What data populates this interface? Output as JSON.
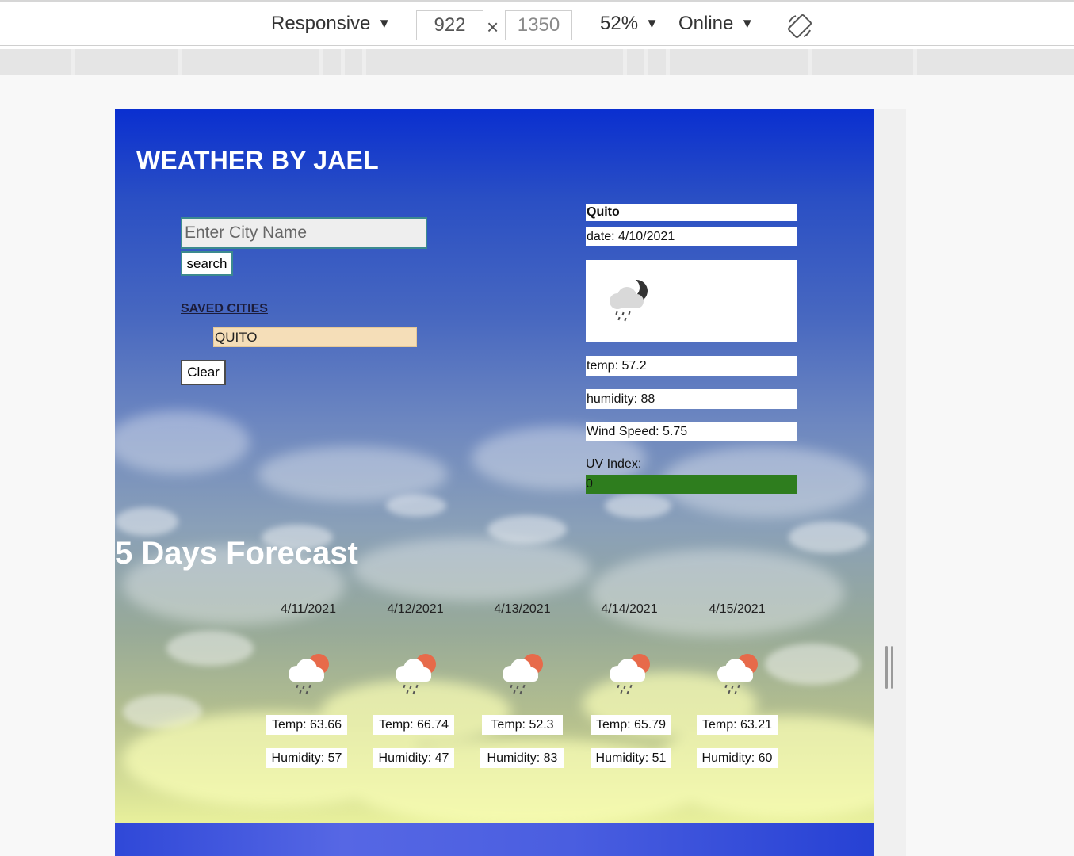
{
  "devtools": {
    "device_label": "Responsive",
    "width_value": "922",
    "height_value": "1350",
    "times_symbol": "×",
    "zoom_label": "52%",
    "network_label": "Online",
    "caret": "▼"
  },
  "app": {
    "title": "WEATHER BY JAEL",
    "search": {
      "placeholder": "Enter City Name",
      "button_label": "search"
    },
    "saved": {
      "heading": "SAVED CITIES",
      "cities": [
        "QUITO"
      ],
      "clear_label": "Clear"
    },
    "current": {
      "city": "Quito",
      "date": "date: 4/10/2021",
      "icon": "night-rain-icon",
      "temp": "temp: 57.2",
      "humidity": "humidity: 88",
      "wind": "Wind Speed: 5.75",
      "uv_label": "UV Index:",
      "uv_value": "0",
      "uv_color": "#2e7d1e"
    },
    "forecast": {
      "title": "5 Days Forecast",
      "days": [
        {
          "date": "4/11/2021",
          "icon": "sun-rain-icon",
          "temp": "Temp: 63.66",
          "humidity": "Humidity: 57"
        },
        {
          "date": "4/12/2021",
          "icon": "sun-rain-icon",
          "temp": "Temp: 66.74",
          "humidity": "Humidity: 47"
        },
        {
          "date": "4/13/2021",
          "icon": "sun-rain-icon",
          "temp": "Temp: 52.3",
          "humidity": "Humidity: 83"
        },
        {
          "date": "4/14/2021",
          "icon": "sun-rain-icon",
          "temp": "Temp: 65.79",
          "humidity": "Humidity: 51"
        },
        {
          "date": "4/15/2021",
          "icon": "sun-rain-icon",
          "temp": "Temp: 63.21",
          "humidity": "Humidity: 60"
        }
      ]
    }
  }
}
